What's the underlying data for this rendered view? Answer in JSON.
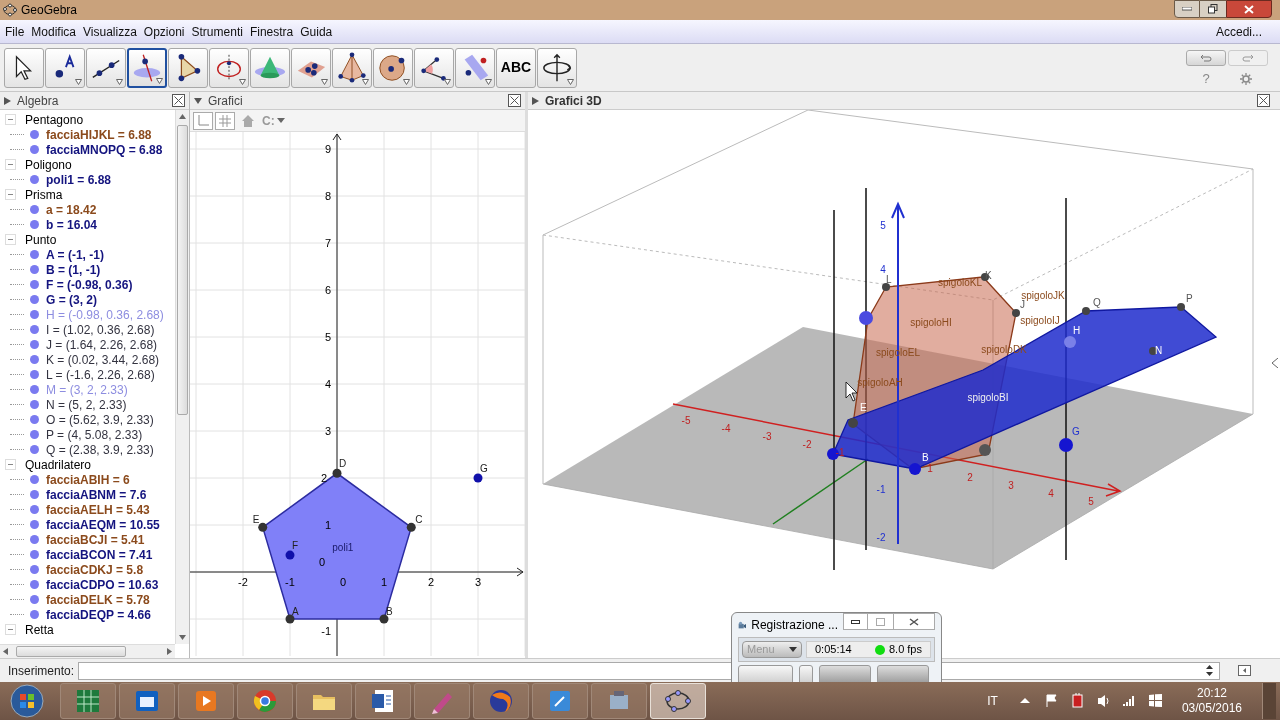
{
  "window": {
    "title": "GeoGebra"
  },
  "menu": [
    "File",
    "Modifica",
    "Visualizza",
    "Opzioni",
    "Strumenti",
    "Finestra",
    "Guida"
  ],
  "sign_in": "Accedi...",
  "tools": [
    {
      "kind": "move",
      "selected": false,
      "menu_arrow": false
    },
    {
      "kind": "point",
      "selected": false,
      "menu_arrow": true
    },
    {
      "kind": "line",
      "selected": false,
      "menu_arrow": true
    },
    {
      "kind": "perpendicular",
      "selected": true,
      "menu_arrow": true
    },
    {
      "kind": "polygon",
      "selected": false,
      "menu_arrow": false
    },
    {
      "kind": "circle_axis",
      "selected": false,
      "menu_arrow": true
    },
    {
      "kind": "cone",
      "selected": false,
      "menu_arrow": false
    },
    {
      "kind": "plane",
      "selected": false,
      "menu_arrow": true
    },
    {
      "kind": "pyramid",
      "selected": false,
      "menu_arrow": true
    },
    {
      "kind": "sphere",
      "selected": false,
      "menu_arrow": true
    },
    {
      "kind": "angle",
      "selected": false,
      "menu_arrow": true
    },
    {
      "kind": "reflect",
      "selected": false,
      "menu_arrow": true
    },
    {
      "kind": "text",
      "label": "ABC",
      "selected": false,
      "menu_arrow": false
    },
    {
      "kind": "rotate",
      "selected": false,
      "menu_arrow": true
    }
  ],
  "help": "?",
  "algebra": {
    "title": "Algebra",
    "expanded": false,
    "groups": [
      {
        "label": "Pentagono",
        "expanded": true,
        "children": [
          {
            "text": "facciaHIJKL = 6.88",
            "color": "#8b4a1c",
            "bold": true
          },
          {
            "text": "facciaMNOPQ = 6.88",
            "color": "#14147f",
            "bold": true
          }
        ]
      },
      {
        "label": "Poligono",
        "expanded": true,
        "children": [
          {
            "text": "poli1 = 6.88",
            "color": "#14147f",
            "bold": true
          }
        ]
      },
      {
        "label": "Prisma",
        "expanded": true,
        "children": [
          {
            "text": "a = 18.42",
            "color": "#8b4a1c",
            "bold": true
          },
          {
            "text": "b = 16.04",
            "color": "#14147f",
            "bold": true
          }
        ]
      },
      {
        "label": "Punto",
        "expanded": true,
        "children": [
          {
            "text": "A = (-1, -1)",
            "color": "#14147f",
            "bold": true
          },
          {
            "text": "B = (1, -1)",
            "color": "#14147f",
            "bold": true
          },
          {
            "text": "F = (-0.98, 0.36)",
            "color": "#14147f",
            "bold": true
          },
          {
            "text": "G = (3, 2)",
            "color": "#14147f",
            "bold": true
          },
          {
            "text": "H = (-0.98, 0.36, 2.68)",
            "color": "#8d8de0",
            "bold": false
          },
          {
            "text": "I = (1.02, 0.36, 2.68)",
            "color": "#333340",
            "bold": false
          },
          {
            "text": "J = (1.64, 2.26, 2.68)",
            "color": "#333340",
            "bold": false
          },
          {
            "text": "K = (0.02, 3.44, 2.68)",
            "color": "#333340",
            "bold": false
          },
          {
            "text": "L = (-1.6, 2.26, 2.68)",
            "color": "#333340",
            "bold": false
          },
          {
            "text": "M = (3, 2, 2.33)",
            "color": "#8d8de0",
            "bold": false
          },
          {
            "text": "N = (5, 2, 2.33)",
            "color": "#333340",
            "bold": false
          },
          {
            "text": "O = (5.62, 3.9, 2.33)",
            "color": "#333340",
            "bold": false
          },
          {
            "text": "P = (4, 5.08, 2.33)",
            "color": "#333340",
            "bold": false
          },
          {
            "text": "Q = (2.38, 3.9, 2.33)",
            "color": "#333340",
            "bold": false
          }
        ]
      },
      {
        "label": "Quadrilatero",
        "expanded": true,
        "children": [
          {
            "text": "facciaABIH = 6",
            "color": "#8b4a1c",
            "bold": true
          },
          {
            "text": "facciaABNM = 7.6",
            "color": "#14147f",
            "bold": true
          },
          {
            "text": "facciaAELH = 5.43",
            "color": "#8b4a1c",
            "bold": true
          },
          {
            "text": "facciaAEQM = 10.55",
            "color": "#14147f",
            "bold": true
          },
          {
            "text": "facciaBCJI = 5.41",
            "color": "#8b4a1c",
            "bold": true
          },
          {
            "text": "facciaBCON = 7.41",
            "color": "#14147f",
            "bold": true
          },
          {
            "text": "facciaCDKJ = 5.8",
            "color": "#8b4a1c",
            "bold": true
          },
          {
            "text": "facciaCDPO = 10.63",
            "color": "#14147f",
            "bold": true
          },
          {
            "text": "facciaDELK = 5.78",
            "color": "#8b4a1c",
            "bold": true
          },
          {
            "text": "facciaDEQP = 4.66",
            "color": "#14147f",
            "bold": true
          }
        ]
      },
      {
        "label": "Retta",
        "expanded": true
      }
    ]
  },
  "graphics": {
    "title": "Grafici",
    "expanded": true,
    "view_menu": "C:",
    "x_ticks": [
      "-2",
      "-1",
      "0",
      "1",
      "2",
      "3"
    ],
    "y_ticks": [
      "9",
      "8",
      "7",
      "6",
      "5",
      "4",
      "3",
      "2",
      "1",
      "0",
      "-1"
    ],
    "points": [
      {
        "label": "A",
        "color": "#333333"
      },
      {
        "label": "B",
        "color": "#333333"
      },
      {
        "label": "C",
        "color": "#333333"
      },
      {
        "label": "D",
        "color": "#333333"
      },
      {
        "label": "E",
        "color": "#333333"
      },
      {
        "label": "F",
        "color": "#1010aa"
      },
      {
        "label": "G",
        "color": "#1010aa"
      }
    ],
    "polygon_label": "poli1"
  },
  "view3d": {
    "title": "Grafici 3D",
    "expanded": false,
    "x_ticks": [
      "-5",
      "-4",
      "-3",
      "-2",
      "-1",
      "1",
      "2",
      "3",
      "4",
      "5"
    ],
    "z_ticks": [
      "5",
      "4",
      "-1",
      "-2"
    ],
    "point_labels": [
      "K",
      "J",
      "Q",
      "P",
      "N",
      "H",
      "G",
      "L",
      "E",
      "B"
    ],
    "edge_labels": [
      "spigoloKL",
      "spigoloJK",
      "spigoloIJ",
      "spigoloHI",
      "spigoloEL",
      "spigoloDK",
      "spigoloAH",
      "spigoloBI"
    ]
  },
  "input_bar": {
    "label": "Inserimento:"
  },
  "recorder": {
    "title": "Registrazione ...",
    "menu": "Menu",
    "menu_disabled": true,
    "elapsed": "0:05:14",
    "fps": "8.0 fps"
  },
  "taskbar": {
    "apps": [
      {
        "kind": "spreadsheet",
        "selected": false
      },
      {
        "kind": "calendar",
        "selected": false
      },
      {
        "kind": "media",
        "selected": false
      },
      {
        "kind": "browser",
        "selected": false
      },
      {
        "kind": "folder",
        "selected": false
      },
      {
        "kind": "document",
        "selected": false
      },
      {
        "kind": "pen",
        "selected": false
      },
      {
        "kind": "fox",
        "selected": false
      },
      {
        "kind": "notes",
        "selected": false
      },
      {
        "kind": "device",
        "selected": false
      },
      {
        "kind": "geometry",
        "selected": true
      }
    ],
    "language": "IT",
    "time": "20:12",
    "date": "03/05/2016"
  }
}
